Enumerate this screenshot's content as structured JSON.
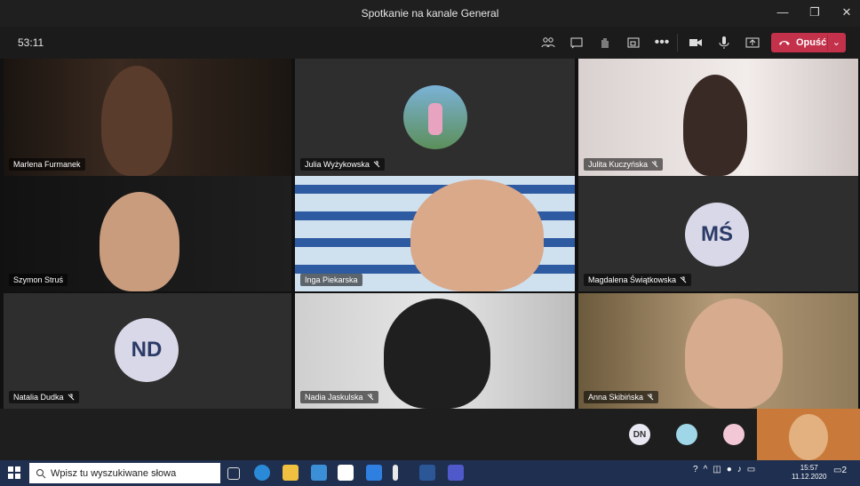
{
  "window": {
    "title": "Spotkanie na kanale General"
  },
  "meeting": {
    "timer": "53:11",
    "leave_label": "Opuść"
  },
  "participants": [
    {
      "name": "Marlena Furmanek"
    },
    {
      "name": "Julia Wyżykowska"
    },
    {
      "name": "Julita Kuczyńska"
    },
    {
      "name": "Szymon Struś"
    },
    {
      "name": "Inga Piekarska"
    },
    {
      "name": "Magdalena Świątkowska",
      "initials": "MŚ"
    },
    {
      "name": "Natalia Dudka",
      "initials": "ND"
    },
    {
      "name": "Nadia Jaskulska"
    },
    {
      "name": "Anna Skibińska"
    }
  ],
  "overflow": {
    "dn_initials": "DN"
  },
  "taskbar": {
    "search_placeholder": "Wpisz tu wyszukiwane słowa",
    "time": "15:57",
    "date": "11.12.2020",
    "notifications": "2"
  },
  "colors": {
    "leave": "#c4314b",
    "initials_bg": "#d8d8e8",
    "initials_fg": "#2b3a67"
  }
}
